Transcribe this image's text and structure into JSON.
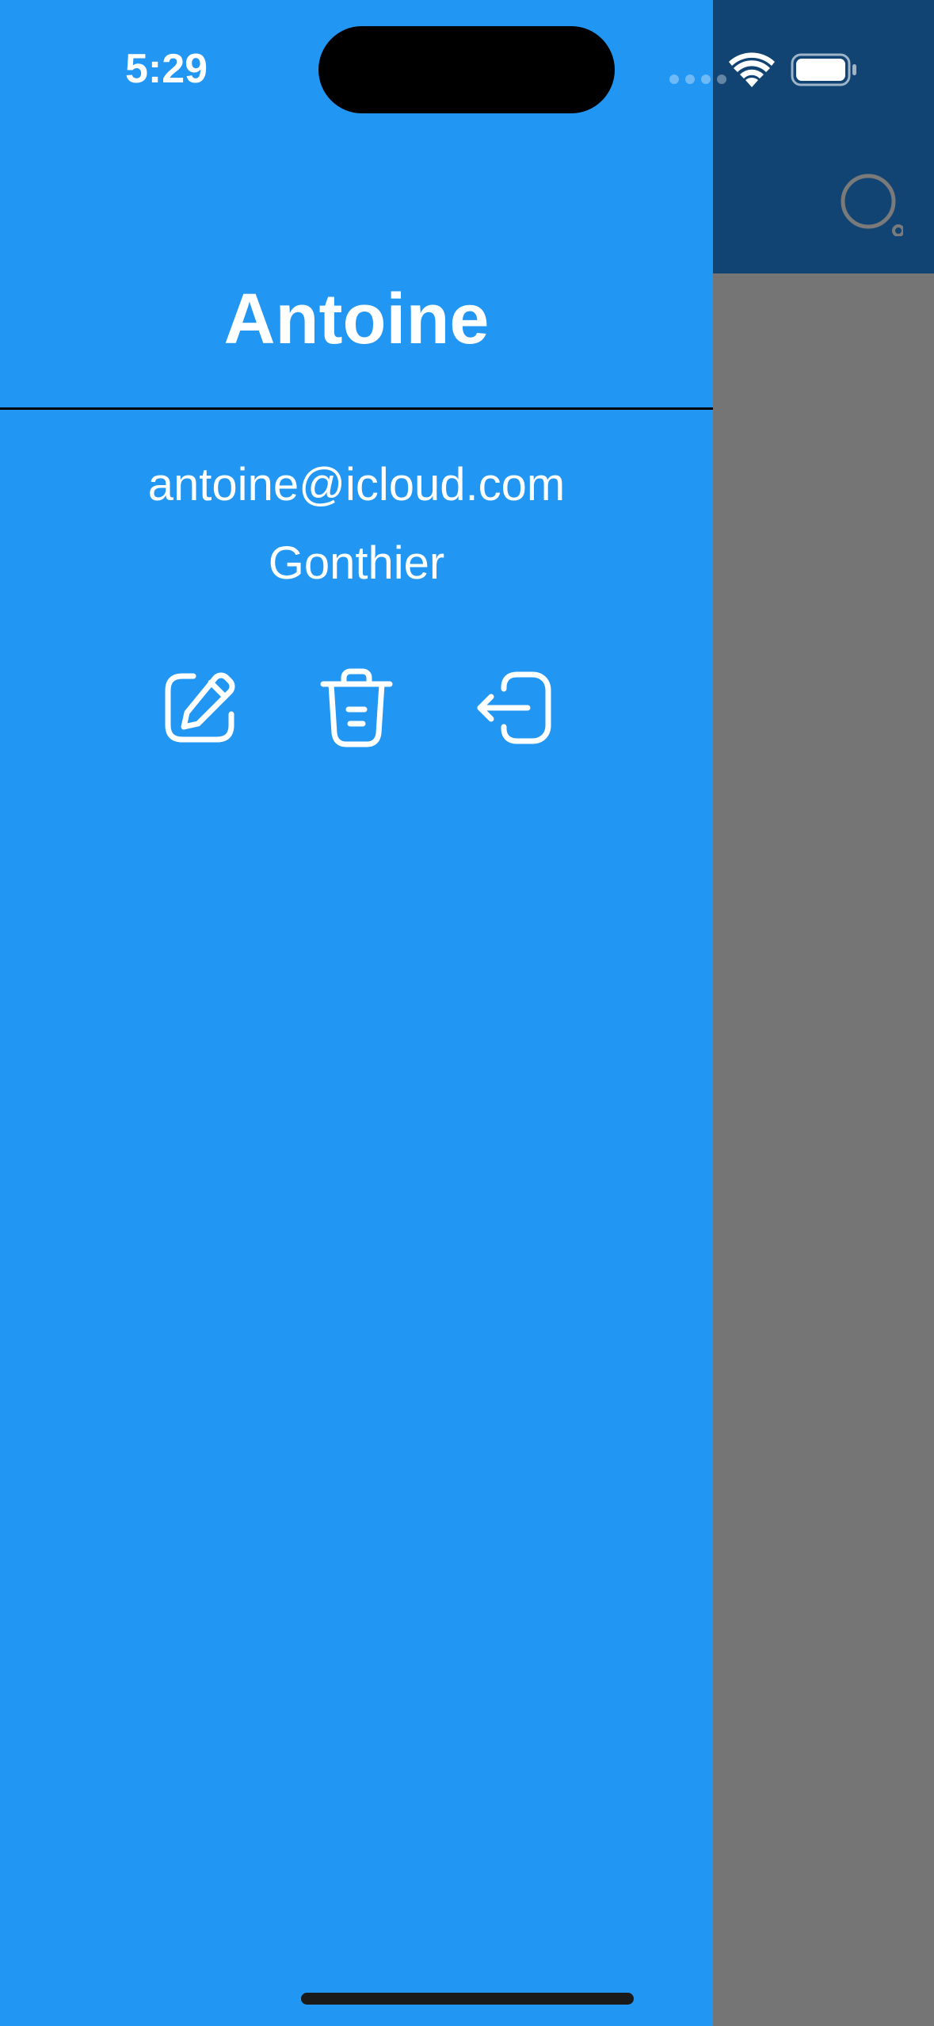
{
  "status_bar": {
    "time": "5:29"
  },
  "drawer": {
    "title": "Antoine",
    "email": "antoine@icloud.com",
    "last_name": "Gonthier",
    "actions": [
      {
        "name": "edit",
        "icon": "edit-icon"
      },
      {
        "name": "delete",
        "icon": "trash-icon"
      },
      {
        "name": "logout",
        "icon": "logout-icon"
      }
    ]
  },
  "colors": {
    "drawer_background": "#2196F3",
    "appbar_background": "#114473",
    "scrim_background": "#757575",
    "text": "#FFFFFF"
  }
}
